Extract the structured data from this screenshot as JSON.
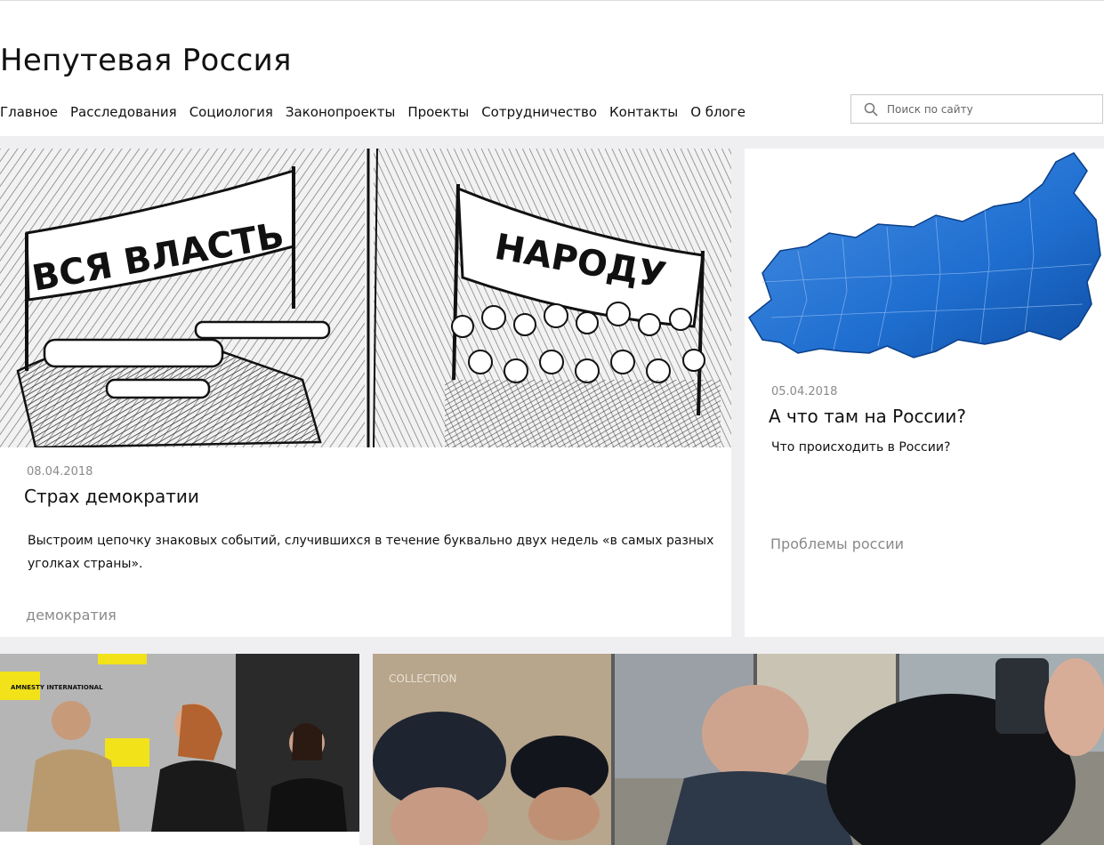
{
  "site": {
    "title": "Непутевая Россия"
  },
  "nav": {
    "items": [
      {
        "label": "Главное"
      },
      {
        "label": "Расследования"
      },
      {
        "label": "Социология"
      },
      {
        "label": "Законопроекты"
      },
      {
        "label": "Проекты"
      },
      {
        "label": "Сотрудничество"
      },
      {
        "label": "Контакты"
      },
      {
        "label": "О блоге"
      }
    ]
  },
  "search": {
    "placeholder": "Поиск по сайту",
    "icon": "search-icon"
  },
  "posts": [
    {
      "date": "08.04.2018",
      "title": "Страх демократии",
      "excerpt": "Выстроим цепочку знаковых событий, случившихся в течение буквально двух недель «в самых разных уголках страны».",
      "tag": "демократия",
      "image": {
        "banner_left": "ВСЯ ВЛАСТЬ",
        "banner_right": "НАРОДУ"
      }
    },
    {
      "date": "05.04.2018",
      "title": "А что там на России?",
      "excerpt": "Что происходить в России?",
      "tag": "Проблемы россии"
    },
    {
      "image": {
        "sign": "AMNESTY INTERNATIONAL"
      }
    },
    {
      "image": {
        "sign": "COLLECTION"
      }
    }
  ],
  "colors": {
    "accent_blue": "#1f6fd1",
    "page_bg": "#efeff2"
  }
}
